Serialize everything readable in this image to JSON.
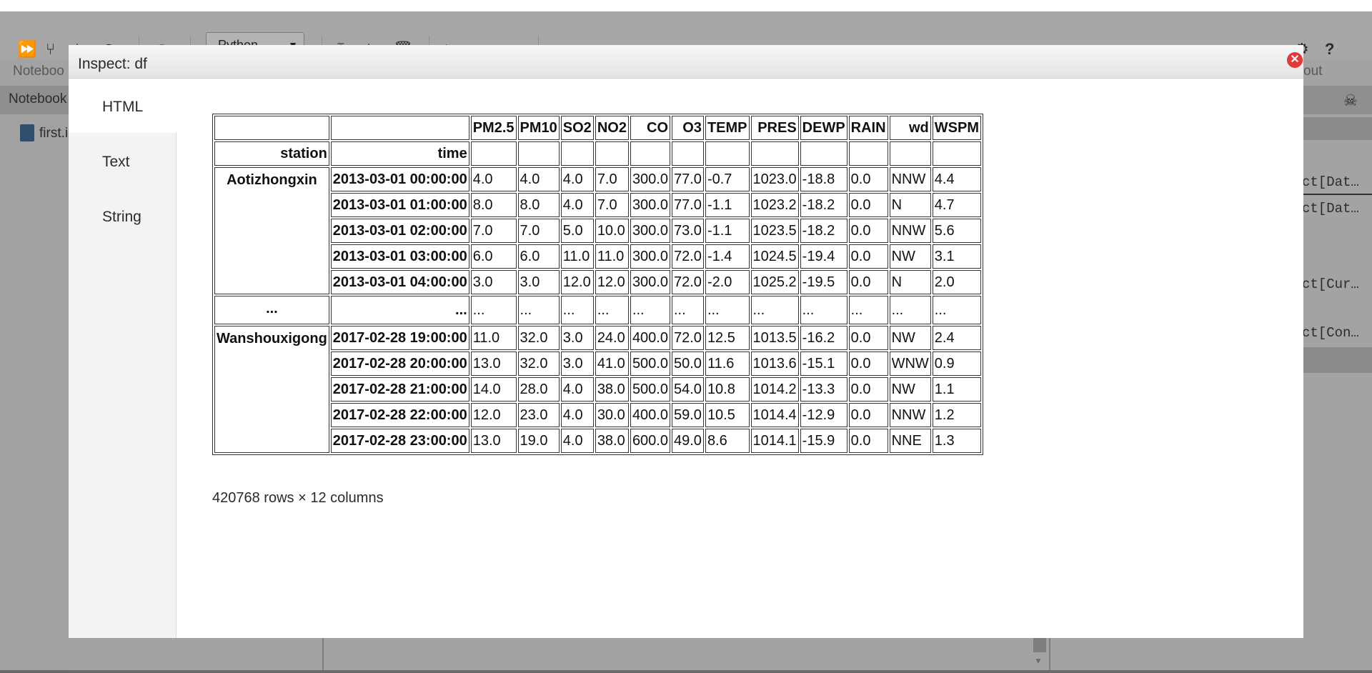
{
  "toolbar": {
    "kernel": "Python",
    "icons": [
      "run-all-icon",
      "branch-icon",
      "download-icon",
      "minus-circle-icon",
      "clock-icon",
      "move-up-icon",
      "move-down-icon",
      "trash-icon",
      "run-icon",
      "run-next-icon",
      "stop-icon",
      "gear-icon",
      "help-icon"
    ]
  },
  "background": {
    "notebook_tab": "Noteboo",
    "about_tab": "out",
    "sidebar_header": "Notebook",
    "file_item": "first.i",
    "right_items": [
      "ct[Dat…",
      "ct[Dat…",
      "ct[Cur…",
      "ct[Con…"
    ]
  },
  "modal": {
    "title": "Inspect: df",
    "tabs": [
      "HTML",
      "Text",
      "String"
    ],
    "active_tab": "HTML",
    "footer": "420768 rows × 12 columns"
  },
  "table": {
    "columns": [
      "PM2.5",
      "PM10",
      "SO2",
      "NO2",
      "CO",
      "O3",
      "TEMP",
      "PRES",
      "DEWP",
      "RAIN",
      "wd",
      "WSPM"
    ],
    "index_names": [
      "station",
      "time"
    ],
    "ellipsis": "...",
    "groups": [
      {
        "station": "Aotizhongxin",
        "rows": [
          {
            "time": "2013-03-01 00:00:00",
            "values": [
              "4.0",
              "4.0",
              "4.0",
              "7.0",
              "300.0",
              "77.0",
              "-0.7",
              "1023.0",
              "-18.8",
              "0.0",
              "NNW",
              "4.4"
            ]
          },
          {
            "time": "2013-03-01 01:00:00",
            "values": [
              "8.0",
              "8.0",
              "4.0",
              "7.0",
              "300.0",
              "77.0",
              "-1.1",
              "1023.2",
              "-18.2",
              "0.0",
              "N",
              "4.7"
            ]
          },
          {
            "time": "2013-03-01 02:00:00",
            "values": [
              "7.0",
              "7.0",
              "5.0",
              "10.0",
              "300.0",
              "73.0",
              "-1.1",
              "1023.5",
              "-18.2",
              "0.0",
              "NNW",
              "5.6"
            ]
          },
          {
            "time": "2013-03-01 03:00:00",
            "values": [
              "6.0",
              "6.0",
              "11.0",
              "11.0",
              "300.0",
              "72.0",
              "-1.4",
              "1024.5",
              "-19.4",
              "0.0",
              "NW",
              "3.1"
            ]
          },
          {
            "time": "2013-03-01 04:00:00",
            "values": [
              "3.0",
              "3.0",
              "12.0",
              "12.0",
              "300.0",
              "72.0",
              "-2.0",
              "1025.2",
              "-19.5",
              "0.0",
              "N",
              "2.0"
            ]
          }
        ]
      },
      {
        "station": "Wanshouxigong",
        "rows": [
          {
            "time": "2017-02-28 19:00:00",
            "values": [
              "11.0",
              "32.0",
              "3.0",
              "24.0",
              "400.0",
              "72.0",
              "12.5",
              "1013.5",
              "-16.2",
              "0.0",
              "NW",
              "2.4"
            ]
          },
          {
            "time": "2017-02-28 20:00:00",
            "values": [
              "13.0",
              "32.0",
              "3.0",
              "41.0",
              "500.0",
              "50.0",
              "11.6",
              "1013.6",
              "-15.1",
              "0.0",
              "WNW",
              "0.9"
            ]
          },
          {
            "time": "2017-02-28 21:00:00",
            "values": [
              "14.0",
              "28.0",
              "4.0",
              "38.0",
              "500.0",
              "54.0",
              "10.8",
              "1014.2",
              "-13.3",
              "0.0",
              "NW",
              "1.1"
            ]
          },
          {
            "time": "2017-02-28 22:00:00",
            "values": [
              "12.0",
              "23.0",
              "4.0",
              "30.0",
              "400.0",
              "59.0",
              "10.5",
              "1014.4",
              "-12.9",
              "0.0",
              "NNW",
              "1.2"
            ]
          },
          {
            "time": "2017-02-28 23:00:00",
            "values": [
              "13.0",
              "19.0",
              "4.0",
              "38.0",
              "600.0",
              "49.0",
              "8.6",
              "1014.1",
              "-15.9",
              "0.0",
              "NNE",
              "1.3"
            ]
          }
        ]
      }
    ]
  }
}
